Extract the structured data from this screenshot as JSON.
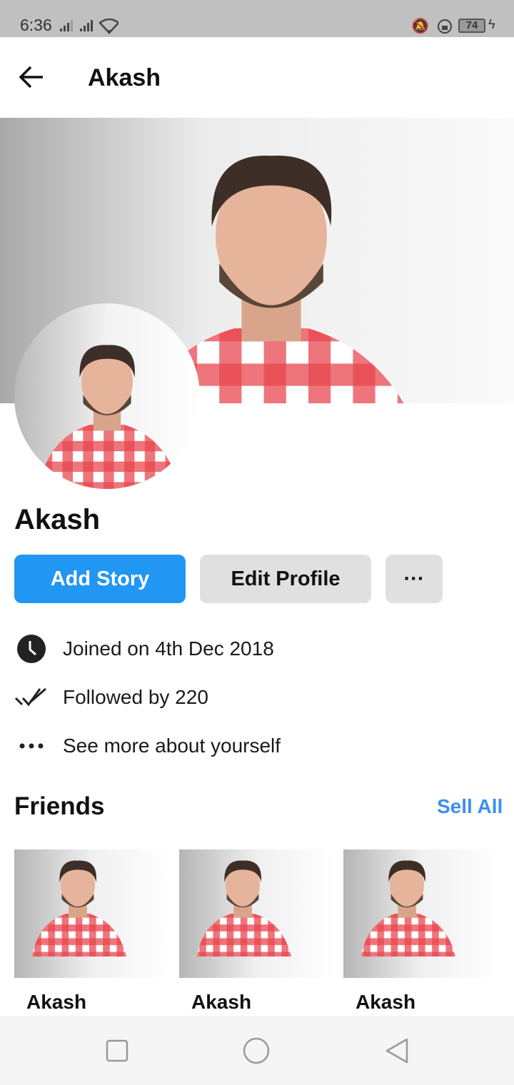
{
  "status_bar": {
    "time": "6:36",
    "battery": "74",
    "icons": [
      "signal-icon",
      "signal-icon",
      "wifi-icon",
      "vibrate-icon",
      "rotation-lock-icon",
      "battery-icon",
      "charging-icon"
    ]
  },
  "header": {
    "title": "Akash",
    "back_icon": "arrow-left-icon"
  },
  "profile": {
    "name": "Akash"
  },
  "actions": {
    "add_story": "Add Story",
    "edit_profile": "Edit Profile",
    "more": "···"
  },
  "info": [
    {
      "icon": "clock-icon",
      "text": "Joined on 4th Dec 2018"
    },
    {
      "icon": "double-check-icon",
      "text": "Followed by 220"
    },
    {
      "icon": "more-horizontal-icon",
      "text": "See more about yourself"
    }
  ],
  "friends": {
    "title": "Friends",
    "see_all": "Sell All",
    "items": [
      {
        "name": "Akash"
      },
      {
        "name": "Akash"
      },
      {
        "name": "Akash"
      }
    ]
  },
  "colors": {
    "accent": "#2196f3",
    "link": "#3b8ff0",
    "button_gray": "#e0e0e0",
    "status_bar": "#c0c0c0"
  }
}
